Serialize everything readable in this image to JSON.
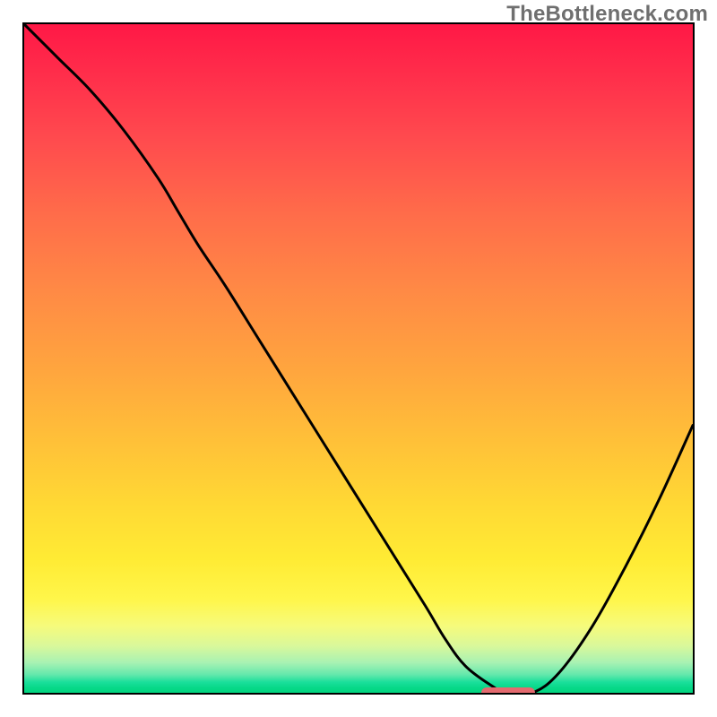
{
  "watermark": "TheBottleneck.com",
  "colors": {
    "border": "#000000",
    "curve": "#000000",
    "marker": "#e46a6f",
    "gradient_top": "#ff1846",
    "gradient_bottom": "#02d47f"
  },
  "chart_data": {
    "type": "line",
    "title": "",
    "xlabel": "",
    "ylabel": "",
    "xlim": [
      0,
      100
    ],
    "ylim": [
      0,
      100
    ],
    "grid": false,
    "legend": false,
    "series": [
      {
        "name": "bottleneck-curve",
        "x": [
          0,
          5,
          10,
          15,
          20,
          23,
          26,
          30,
          35,
          40,
          45,
          50,
          55,
          60,
          63,
          66,
          70,
          72,
          76,
          80,
          85,
          90,
          95,
          100
        ],
        "y": [
          100,
          95,
          90,
          84,
          77,
          72,
          67,
          61,
          53,
          45,
          37,
          29,
          21,
          13,
          8,
          4,
          1,
          0,
          0,
          3,
          10,
          19,
          29,
          40
        ]
      }
    ],
    "marker": {
      "name": "optimal-range",
      "x_start": 68,
      "x_end": 76,
      "y": 0
    },
    "note": "Values estimated from pixel positions; y is percent (100=top of plot, 0=bottom green band)."
  }
}
